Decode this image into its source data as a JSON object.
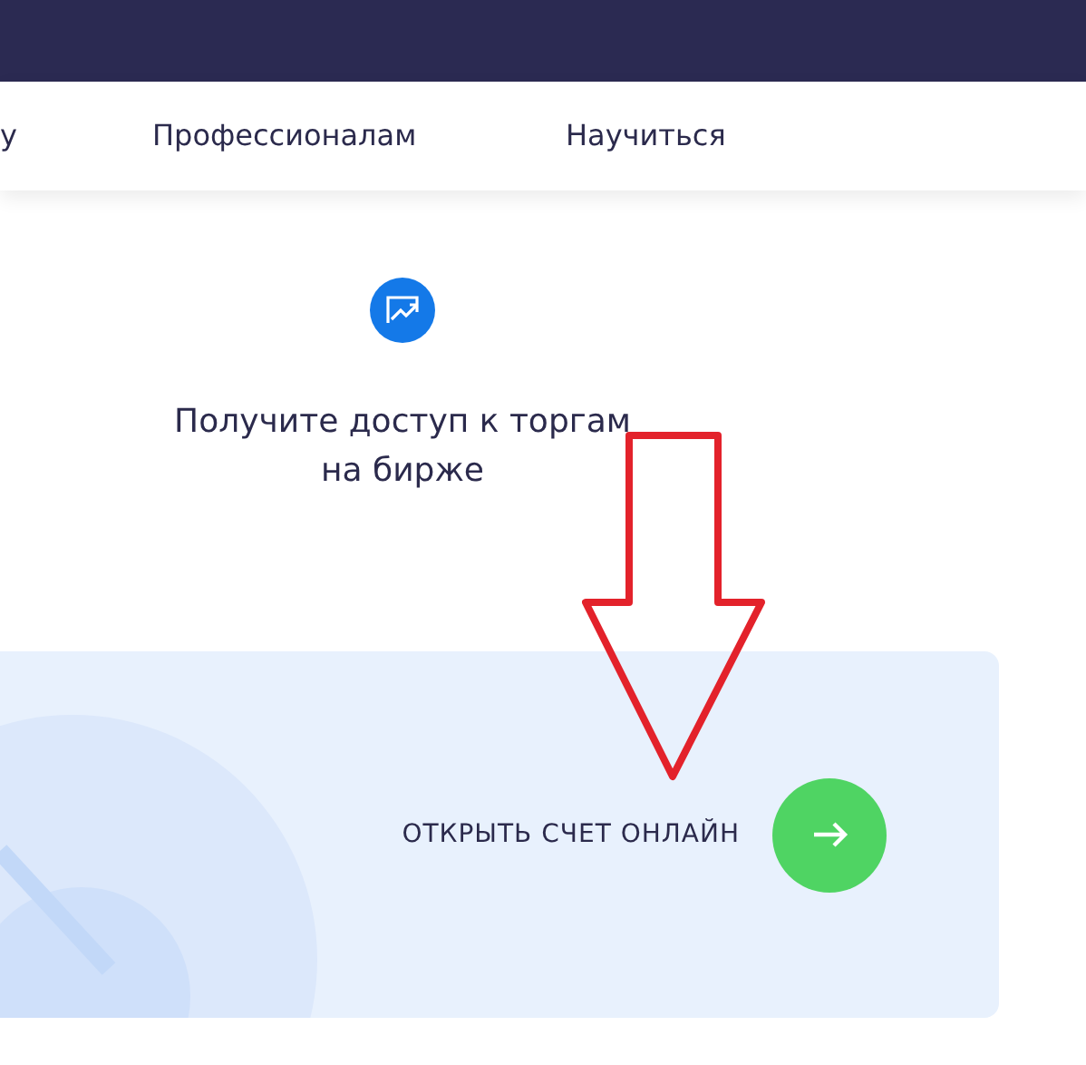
{
  "nav": {
    "items": [
      {
        "label": "у"
      },
      {
        "label": "Профессионалам"
      },
      {
        "label": "Научиться"
      }
    ]
  },
  "promo": {
    "text": "Получите доступ к торгам на бирже"
  },
  "cta": {
    "label": "ОТКРЫТЬ СЧЕТ ОНЛАЙН"
  }
}
